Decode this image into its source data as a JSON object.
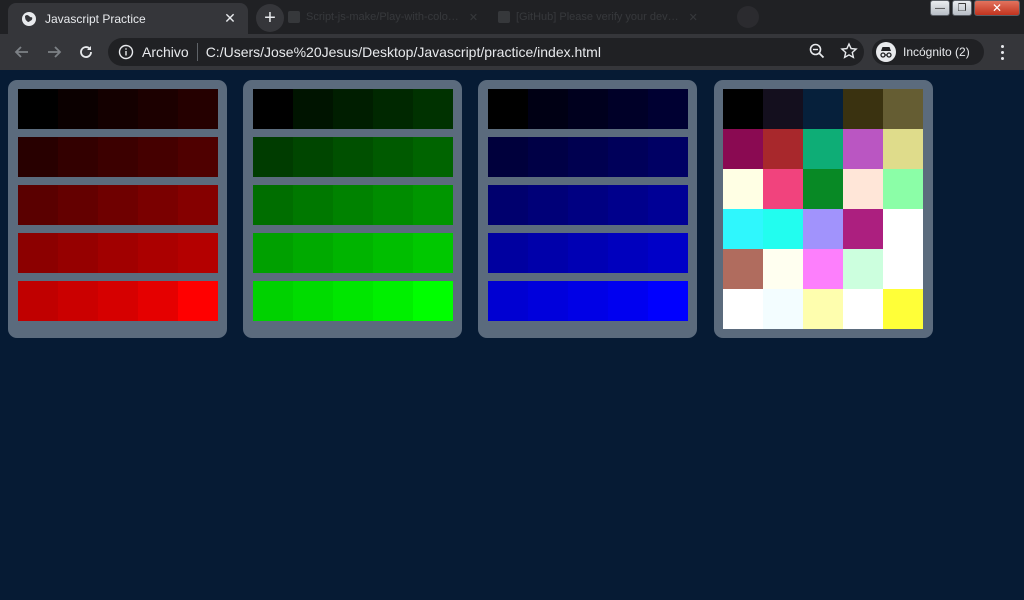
{
  "browser": {
    "active_tab": {
      "title": "Javascript Practice",
      "close_glyph": "✕",
      "icon": "globe-icon"
    },
    "new_tab_glyph": "+",
    "background_tabs": [
      {
        "title": "Script-js-make/Play-with-colo…",
        "close_glyph": "✕"
      },
      {
        "title": "[GitHub] Please verify your dev…",
        "close_glyph": "✕"
      }
    ],
    "window_controls": {
      "minimize": "—",
      "maximize": "❐",
      "close": "✕"
    },
    "address_bar": {
      "site_info_label": "Archivo",
      "url": "C:/Users/Jose%20Jesus/Desktop/Javascript/practice/index.html"
    },
    "profile": {
      "label": "Incógnito (2)",
      "icon": "incognito-icon"
    }
  },
  "colors": {
    "page_background": "#061b34",
    "card_background": "#5b6b7d",
    "chrome_dark": "#202124",
    "chrome_toolbar": "#35363a"
  },
  "palettes": {
    "red": [
      [
        "#000000",
        "#0b0000",
        "#140000",
        "#1c0000",
        "#250000"
      ],
      [
        "#280000",
        "#330000",
        "#3c0000",
        "#450000",
        "#4f0000"
      ],
      [
        "#5a0000",
        "#640000",
        "#6f0000",
        "#7a0000",
        "#850000"
      ],
      [
        "#8c0000",
        "#960000",
        "#a10000",
        "#ab0000",
        "#b40000"
      ],
      [
        "#c00000",
        "#cb0000",
        "#d60000",
        "#e50000",
        "#ff0000"
      ]
    ],
    "green": [
      [
        "#000000",
        "#001400",
        "#001e00",
        "#002800",
        "#003200"
      ],
      [
        "#003c00",
        "#004600",
        "#005000",
        "#005a00",
        "#006400"
      ],
      [
        "#006e00",
        "#007800",
        "#008200",
        "#008c00",
        "#009600"
      ],
      [
        "#00a000",
        "#00aa00",
        "#00b400",
        "#00be00",
        "#00c800"
      ],
      [
        "#00d200",
        "#00dc00",
        "#00e600",
        "#00f000",
        "#00ff00"
      ]
    ],
    "blue": [
      [
        "#000000",
        "#000014",
        "#00001e",
        "#000028",
        "#000032"
      ],
      [
        "#00003c",
        "#000046",
        "#000050",
        "#00005a",
        "#000064"
      ],
      [
        "#00006e",
        "#000078",
        "#000082",
        "#00008c",
        "#000096"
      ],
      [
        "#0000a0",
        "#0000aa",
        "#0000b4",
        "#0000be",
        "#0000c8"
      ],
      [
        "#0000d2",
        "#0000dc",
        "#0000e6",
        "#0000f0",
        "#0000ff"
      ]
    ],
    "random": [
      [
        "#000000",
        "#140f1e",
        "#06203b",
        "#3a3210",
        "#655d33"
      ],
      [
        "#8a0a52",
        "#a8282c",
        "#0ead76",
        "#ba56c2",
        "#dfdc8b"
      ],
      [
        "#ffffe4",
        "#f1437d",
        "#088925",
        "#ffe6d8",
        "#8bfea7"
      ],
      [
        "#2ff7fd",
        "#22fdef",
        "#a193fc",
        "#ac1f7f",
        "#ffffff"
      ],
      [
        "#b06c5e",
        "#fffff0",
        "#fd7ffc",
        "#ccffde",
        "#ffffff"
      ],
      [
        "#ffffff",
        "#f3fdff",
        "#fefeae",
        "#ffffff",
        "#ffff38"
      ]
    ]
  }
}
